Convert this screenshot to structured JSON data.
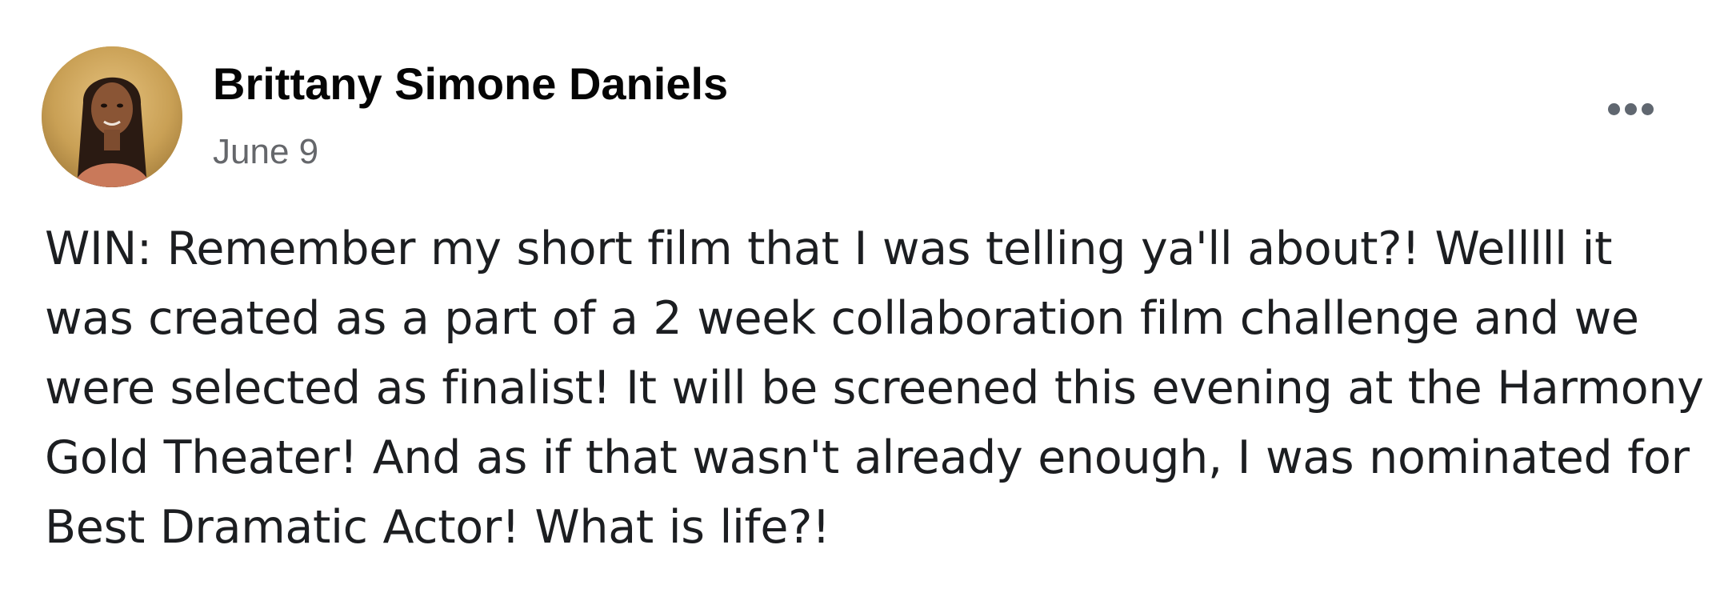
{
  "post": {
    "author_name": "Brittany Simone Daniels",
    "date": "June 9",
    "body_lines": [
      "WIN: Remember my short film that I was telling ya'll about?! Welllll it",
      "was created as a part of a 2 week collaboration film challenge and we",
      "were selected as finalist! It will be screened this evening at the Harmony",
      "Gold Theater! And as if that wasn't already enough, I was nominated for",
      "Best Dramatic Actor! What is life?!"
    ]
  },
  "icons": {
    "more_options": "more-options-icon",
    "avatar": "profile-photo"
  },
  "colors": {
    "name": "#050505",
    "date": "#65676b",
    "body": "#1c1e21",
    "more_dots": "#606770"
  }
}
